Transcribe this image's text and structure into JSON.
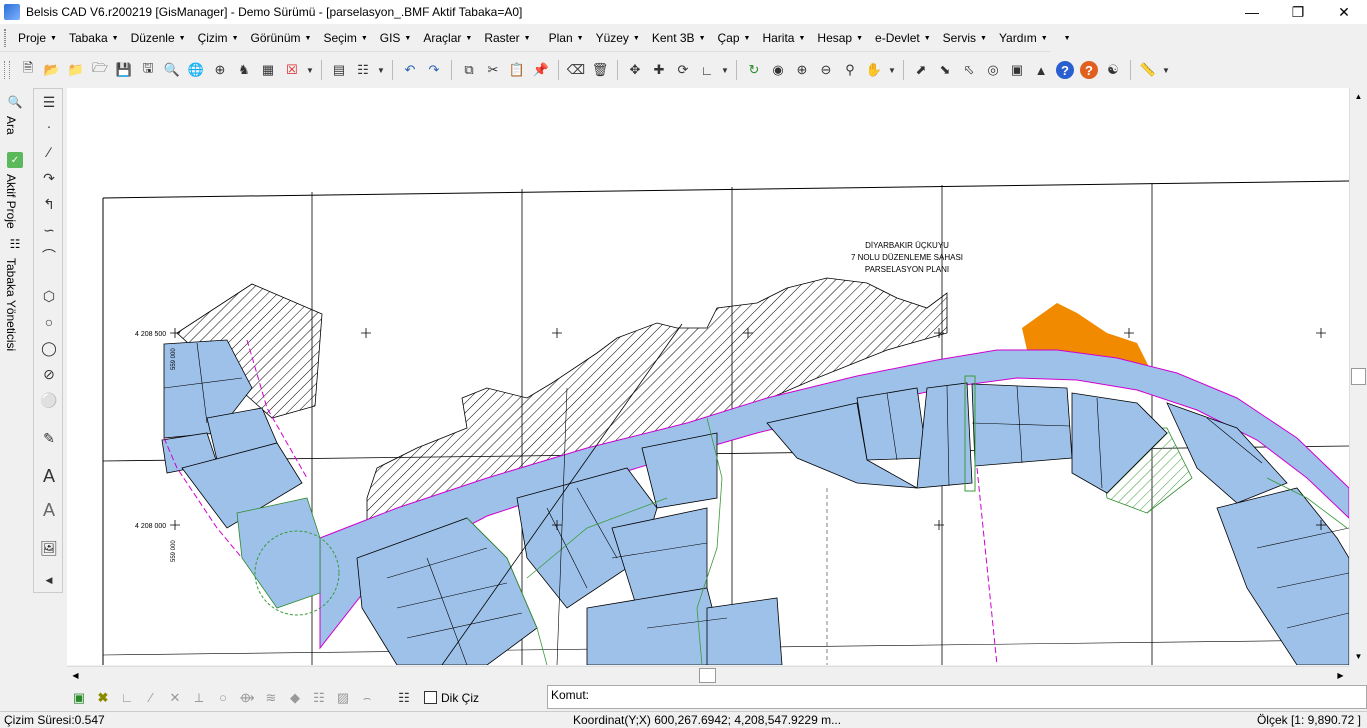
{
  "window": {
    "title": "Belsis CAD V6.r200219 [GisManager] - Demo Sürümü - [parselasyon_.BMF  Aktif Tabaka=A0]",
    "minimize_icon": "minimize-icon",
    "maximize_icon": "restore-icon",
    "close_icon": "close-icon"
  },
  "menu": {
    "items": [
      {
        "label": "Proje"
      },
      {
        "label": "Tabaka"
      },
      {
        "label": "Düzenle"
      },
      {
        "label": "Çizim"
      },
      {
        "label": "Görünüm"
      },
      {
        "label": "Seçim"
      },
      {
        "label": "GIS"
      },
      {
        "label": "Araçlar"
      },
      {
        "label": "Raster"
      },
      {
        "label": "Plan"
      },
      {
        "label": "Yüzey"
      },
      {
        "label": "Kent 3B"
      },
      {
        "label": "Çap"
      },
      {
        "label": "Harita"
      },
      {
        "label": "Hesap"
      },
      {
        "label": "e-Devlet"
      },
      {
        "label": "Servis"
      },
      {
        "label": "Yardım"
      }
    ]
  },
  "left_panel": {
    "search_label": "Ara",
    "active_project_label": "Aktif Proje",
    "layer_manager_label": "Tabaka Yöneticisi"
  },
  "map": {
    "title_lines": [
      "DİYARBAKIR ÜÇKUYU",
      "7 NOLU DÜZENLEME SAHASI",
      "PARSELASYON  PLANI"
    ],
    "coord_labels": [
      "4 208 500",
      "4 208 000"
    ],
    "left_coord_labels": [
      "559 000",
      "559 000"
    ],
    "colors": {
      "road_fill": "#9ec1ea",
      "parcel_fill": "#9ec1ea",
      "highlight_fill": "#f28a00",
      "green_zone": "#6fbf5f",
      "outline": "#000000",
      "magenta_line": "#d000d0"
    }
  },
  "command": {
    "dik_ciz_label": "Dik Çiz",
    "prompt_label": "Komut:"
  },
  "status": {
    "drawing_time": "Çizim Süresi:0.547",
    "coordinates": "Koordinat(Y;X)  600,267.6942; 4,208,547.9229 m...",
    "scale": "Ölçek [1: 9,890.72 ]"
  }
}
